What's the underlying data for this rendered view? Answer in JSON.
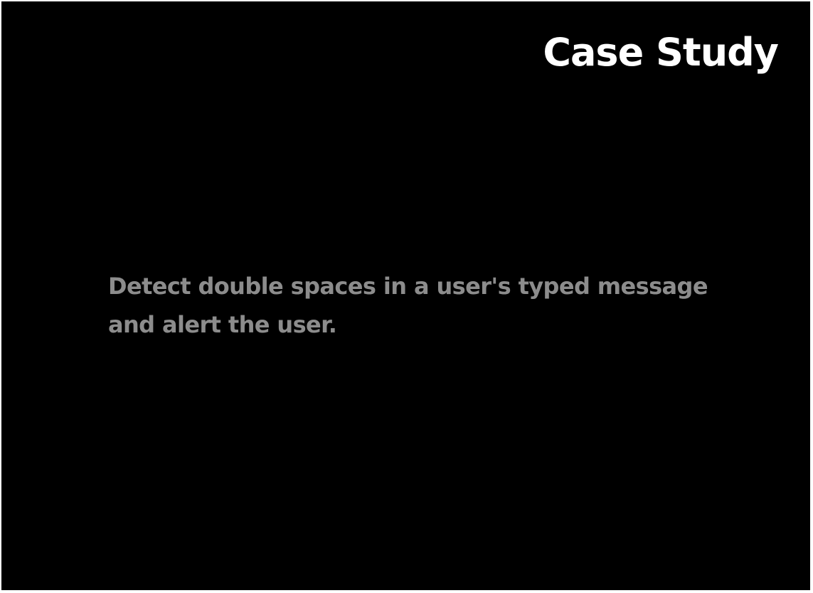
{
  "slide": {
    "title": "Case Study",
    "body": "Detect double spaces in a user's typed message and alert the user.",
    "colors": {
      "background": "#000000",
      "title": "#ffffff",
      "body": "#8c8c8c"
    }
  }
}
